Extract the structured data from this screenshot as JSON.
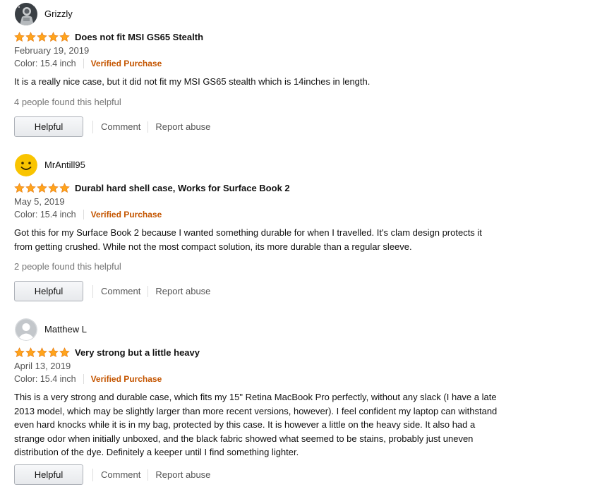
{
  "colors": {
    "star": "#ffa41c",
    "verified": "#c45500",
    "link": "#555555"
  },
  "reviews": [
    {
      "author": "Grizzly",
      "avatar": "astronaut-photo-avatar",
      "rating": 5,
      "title": "Does not fit MSI GS65 Stealth",
      "date": "February 19, 2019",
      "color": "Color: 15.4 inch",
      "verified": "Verified Purchase",
      "body": "It is a really nice case, but it did not fit my MSI GS65 stealth which is 14inches in length.",
      "helpful_count": "4 people found this helpful",
      "helpful_label": "Helpful",
      "comment_label": "Comment",
      "report_label": "Report abuse"
    },
    {
      "author": "MrAntill95",
      "avatar": "smiley-face-avatar",
      "rating": 5,
      "title": "Durabl hard shell case, Works for Surface Book 2",
      "date": "May 5, 2019",
      "color": "Color: 15.4 inch",
      "verified": "Verified Purchase",
      "body": "Got this for my Surface Book 2 because I wanted something durable for when I travelled. It's clam design protects it from getting crushed. While not the most compact solution, its more durable than a regular sleeve.",
      "helpful_count": "2 people found this helpful",
      "helpful_label": "Helpful",
      "comment_label": "Comment",
      "report_label": "Report abuse"
    },
    {
      "author": "Matthew L",
      "avatar": "default-user-avatar",
      "rating": 5,
      "title": "Very strong but a little heavy",
      "date": "April 13, 2019",
      "color": "Color: 15.4 inch",
      "verified": "Verified Purchase",
      "body": "This is a very strong and durable case, which fits my 15\" Retina MacBook Pro perfectly, without any slack (I have a late 2013 model, which may be slightly larger than more recent versions, however). I feel confident my laptop can withstand even hard knocks while it is in my bag, protected by this case. It is however a little on the heavy side. It also had a strange odor when initially unboxed, and the black fabric showed what seemed to be stains, probably just uneven distribution of the dye. Definitely a keeper until I find something lighter.",
      "helpful_label": "Helpful",
      "comment_label": "Comment",
      "report_label": "Report abuse"
    }
  ]
}
